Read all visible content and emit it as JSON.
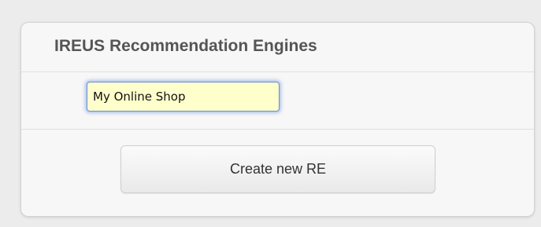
{
  "panel": {
    "title": "IREUS Recommendation Engines"
  },
  "form": {
    "name_value": "My Online Shop",
    "name_placeholder": ""
  },
  "actions": {
    "create_label": "Create new RE"
  },
  "colors": {
    "input_background": "#ffffcc",
    "focus_ring": "#6a8fd0",
    "title_text": "#555555"
  }
}
